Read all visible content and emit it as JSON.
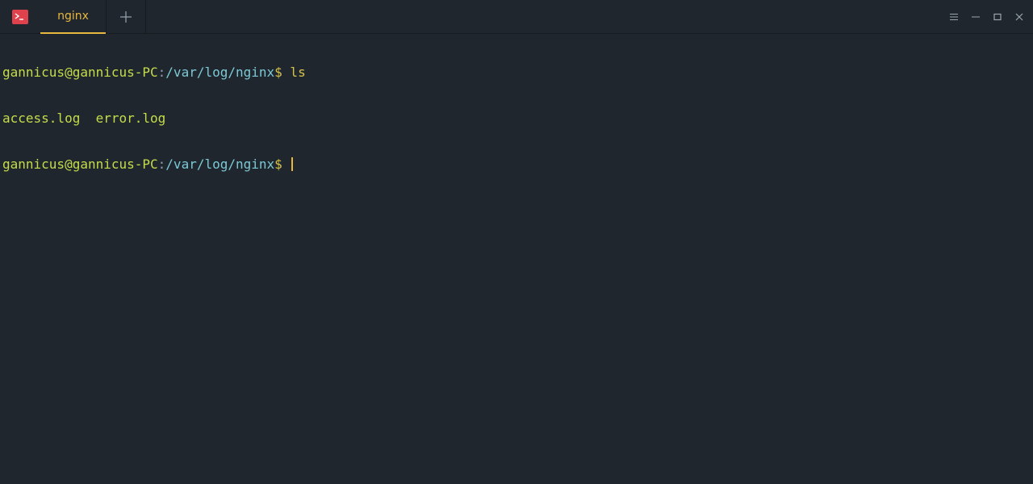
{
  "titlebar": {
    "tab_label": "nginx",
    "app_icon": "terminal-app-icon",
    "new_tab_icon": "plus-icon",
    "controls": [
      "menu-icon",
      "minimize-icon",
      "maximize-icon",
      "close-icon"
    ]
  },
  "terminal": {
    "lines": [
      {
        "user": "gannicus@gannicus-PC",
        "colon": ":",
        "path": "/var/log/nginx",
        "dollar": "$",
        "command": " ls"
      },
      {
        "output": "access.log  error.log"
      },
      {
        "user": "gannicus@gannicus-PC",
        "colon": ":",
        "path": "/var/log/nginx",
        "dollar": "$",
        "command": " "
      }
    ]
  },
  "colors": {
    "background": "#1f262d",
    "accent": "#e8b83e",
    "user": "#c5dc4a",
    "path": "#7cc9d6",
    "app_icon": "#e0424d"
  }
}
